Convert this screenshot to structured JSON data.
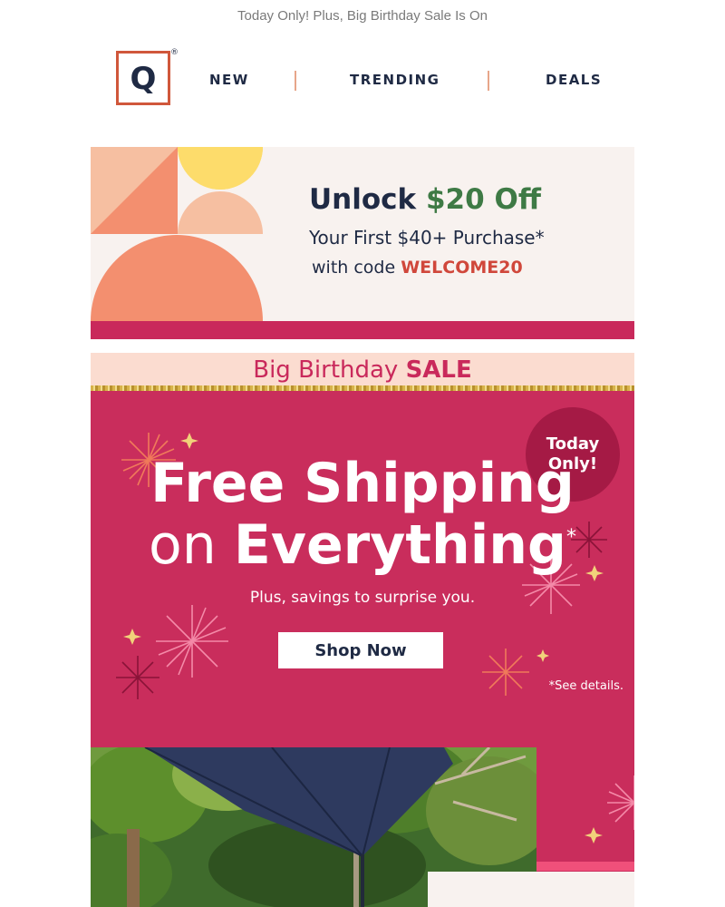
{
  "preheader": {
    "text": "Today Only! Plus, Big Birthday Sale Is On"
  },
  "header": {
    "logo_letter": "Q",
    "logo_mark": "®",
    "nav": [
      {
        "label": "NEW"
      },
      {
        "label": "TRENDING"
      },
      {
        "label": "DEALS"
      }
    ]
  },
  "promo": {
    "headline_prefix": "Unlock",
    "headline_amount": "$20 Off",
    "line2": "Your First $40+ Purchase*",
    "line3_prefix": "with code",
    "code": "WELCOME20"
  },
  "birthday_bar": {
    "text": "Big Birthday",
    "emphasis": "SALE"
  },
  "hero": {
    "line1": "Free Shipping",
    "line2_prefix": "on",
    "line2_emphasis": "Everything",
    "line2_mark": "*",
    "subtext": "Plus, savings to surprise you.",
    "cta": "Shop Now",
    "disclaimer": "*See details.",
    "badge_line1": "Today",
    "badge_line2": "Only!"
  },
  "colors": {
    "brand_navy": "#1f2a44",
    "brand_orange": "#d0573b",
    "hero_pink": "#c92d5c",
    "badge_maroon": "#a51a45",
    "promo_green": "#3e7a45",
    "promo_bg": "#f8f2ef",
    "bar_bg": "#fbdcd0"
  }
}
